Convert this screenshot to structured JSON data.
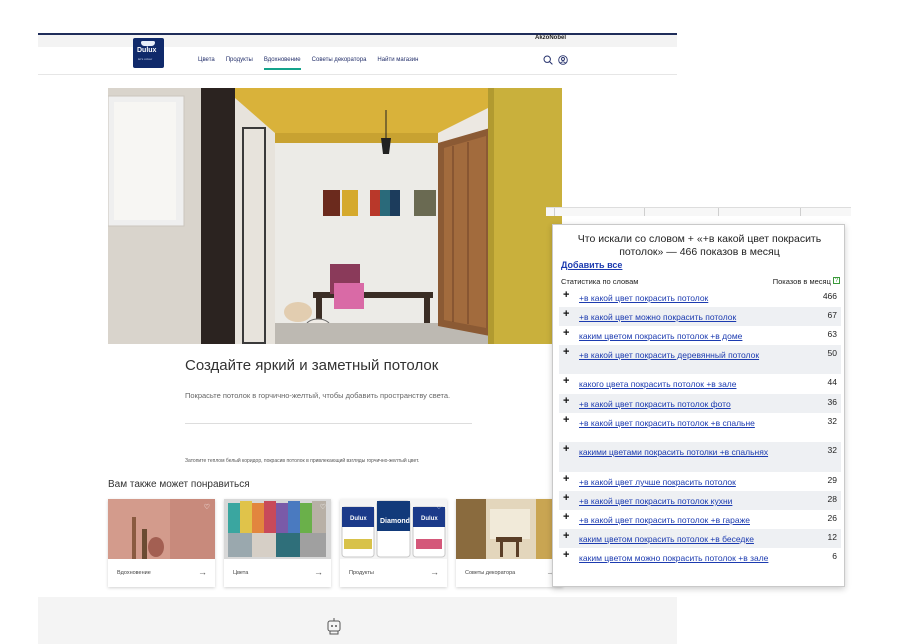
{
  "site": {
    "topbar_brand": "AkzoNobel",
    "logo": {
      "text": "Dulux",
      "sub": "let's colour"
    },
    "nav": [
      "Цвета",
      "Продукты",
      "Вдохновение",
      "Советы декоратора",
      "Найти магазин"
    ],
    "nav_active_index": 2,
    "icons": [
      "search-icon",
      "user-icon"
    ],
    "hero_title": "Создайте яркий и заметный потолок",
    "hero_text": "Покрасьте потолок в горчично-желтый, чтобы добавить пространству света.",
    "caption": "Затопите теплом белый коридор, покрасив потолок в привлекающий взгляды горчично-желтый цвет.",
    "also_title": "Вам также может понравиться",
    "cards": [
      {
        "label": "Вдохновение"
      },
      {
        "label": "Цвета"
      },
      {
        "label": "Продукты"
      },
      {
        "label": "Советы декоратора"
      }
    ],
    "product_labels": [
      "Dulux",
      "Diamond",
      "Dulux"
    ],
    "accent_color": "#14a38b",
    "brand_color": "#102a6b"
  },
  "popup": {
    "title": "Что искали со словом + «+в какой цвет покрасить потолок» — 466 показов в месяц",
    "add_all": "Добавить все",
    "col_phrase": "Статистика по словам",
    "col_count": "Показов в месяц",
    "help_mark": "?",
    "rows": [
      {
        "phrase": "+в какой цвет покрасить потолок",
        "count": "466"
      },
      {
        "phrase": "+в какой цвет можно покрасить потолок",
        "count": "67"
      },
      {
        "phrase": "каким цветом покрасить потолок +в доме",
        "count": "63"
      },
      {
        "phrase": "+в какой цвет покрасить деревянный потолок",
        "count": "50"
      },
      {
        "phrase": "какого цвета покрасить потолок +в зале",
        "count": "44"
      },
      {
        "phrase": "+в какой цвет покрасить потолок фото",
        "count": "36"
      },
      {
        "phrase": "+в какой цвет покрасить потолок +в спальне",
        "count": "32"
      },
      {
        "phrase": "какими цветами покрасить потолки +в спальнях",
        "count": "32"
      },
      {
        "phrase": "+в какой цвет лучше покрасить потолок",
        "count": "29"
      },
      {
        "phrase": "+в какой цвет покрасить потолок кухни",
        "count": "28"
      },
      {
        "phrase": "+в какой цвет покрасить потолок +в гараже",
        "count": "26"
      },
      {
        "phrase": "каким цветом покрасить потолок +в беседке",
        "count": "12"
      },
      {
        "phrase": "каким цветом можно покрасить потолок +в зале",
        "count": "6"
      }
    ]
  }
}
